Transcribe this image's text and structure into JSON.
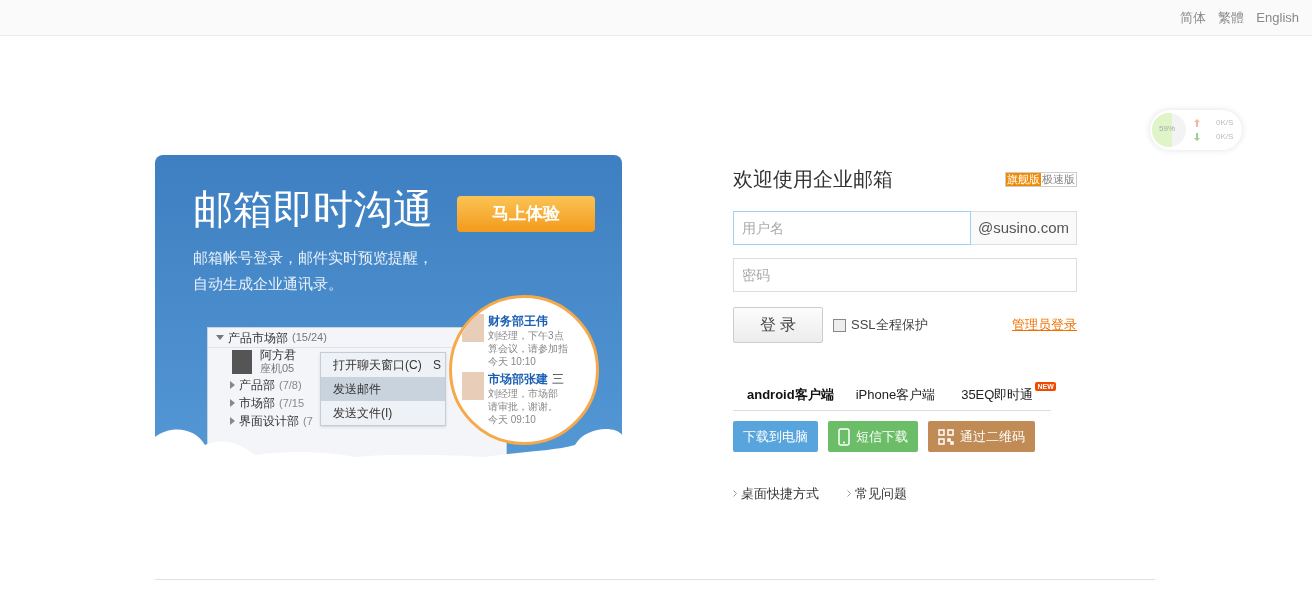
{
  "language_links": [
    "简体",
    "繁體",
    "English"
  ],
  "speed_widget": {
    "percent": "59%",
    "level": 0.59,
    "upload": "0K/S",
    "download": "0K/S"
  },
  "banner": {
    "title": "邮箱即时沟通",
    "cta": "马上体验",
    "subtitle_lines": [
      "邮箱帐号登录，邮件实时预览提醒，",
      "自动生成企业通讯录。"
    ],
    "app_window": {
      "group": "产品市场部",
      "group_count": "(15/24)",
      "contact_name": "阿方君",
      "contact_phone": "座机05",
      "subgroups": [
        {
          "name": "产品部",
          "count": "(7/8)"
        },
        {
          "name": "市场部",
          "count": "(7/15"
        },
        {
          "name": "界面设计部",
          "count": "(7"
        }
      ],
      "menu": [
        {
          "label": "打开聊天窗口(C)",
          "selected": false
        },
        {
          "label": "发送邮件",
          "selected": true
        },
        {
          "label": "发送文件(I)",
          "selected": false
        }
      ],
      "menu_shortcut": "S"
    },
    "notifications": [
      {
        "sender": "财务部王伟",
        "lines": [
          "刘经理，下午3点",
          "算会议，请参加指"
        ],
        "time": "今天 10:10"
      },
      {
        "sender": "市场部张建",
        "extra": "三",
        "lines": [
          "刘经理，市场部",
          "请审批，谢谢。"
        ],
        "time": "今天 09:10"
      }
    ]
  },
  "login": {
    "title": "欢迎使用企业邮箱",
    "editions": [
      {
        "label": "旗舰版",
        "selected": true
      },
      {
        "label": "极速版",
        "selected": false
      }
    ],
    "username": {
      "placeholder": "用户名"
    },
    "domain": "@susino.com",
    "password": {
      "placeholder": "密码"
    },
    "submit": "登 录",
    "ssl": {
      "label": "SSL全程保护",
      "checked": false
    },
    "admin_link": "管理员登录",
    "client_tabs": [
      {
        "label": "android客户端",
        "selected": true
      },
      {
        "label": "iPhone客户端",
        "selected": false
      },
      {
        "label": "35EQ即时通",
        "selected": false,
        "badge": "NEW"
      }
    ],
    "download_buttons": [
      {
        "kind": "computer",
        "label": "下载到电脑",
        "color": "#57a5dc"
      },
      {
        "kind": "phone",
        "label": "短信下载",
        "color": "#6bbd68"
      },
      {
        "kind": "qrcode",
        "label": "通过二维码",
        "color": "#c08b55"
      }
    ],
    "links": [
      "桌面快捷方式",
      "常见问题"
    ]
  }
}
